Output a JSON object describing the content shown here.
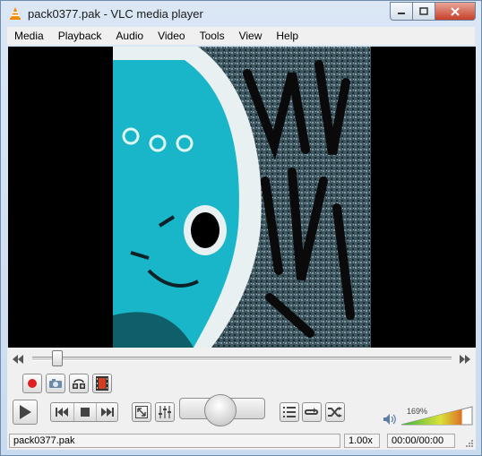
{
  "window": {
    "title": "pack0377.pak - VLC media player",
    "icon": "vlc-cone-icon"
  },
  "caption_buttons": {
    "minimize_icon": "minimize-icon",
    "maximize_icon": "maximize-icon",
    "close_icon": "close-icon"
  },
  "menubar": {
    "items": [
      {
        "label": "Media"
      },
      {
        "label": "Playback"
      },
      {
        "label": "Audio"
      },
      {
        "label": "Video"
      },
      {
        "label": "Tools"
      },
      {
        "label": "View"
      },
      {
        "label": "Help"
      }
    ]
  },
  "video": {
    "artwork": "cover-art-image"
  },
  "seek": {
    "position_fraction": 0.06
  },
  "toolbar_top": [
    {
      "name": "record-button",
      "icon": "record-icon"
    },
    {
      "name": "snapshot-button",
      "icon": "camera-icon"
    },
    {
      "name": "loop-ab-button",
      "icon": "loop-ab-icon"
    },
    {
      "name": "frame-by-frame-button",
      "icon": "film-frame-icon"
    }
  ],
  "toolbar_bottom": [
    {
      "name": "play-button",
      "icon": "play-icon"
    },
    {
      "name": "previous-button",
      "icon": "skip-back-icon"
    },
    {
      "name": "stop-button",
      "icon": "stop-icon"
    },
    {
      "name": "next-button",
      "icon": "skip-forward-icon"
    },
    {
      "name": "fullscreen-button",
      "icon": "fullscreen-icon"
    },
    {
      "name": "extended-settings-button",
      "icon": "equalizer-icon"
    },
    {
      "name": "playlist-button",
      "icon": "playlist-icon"
    },
    {
      "name": "loop-button",
      "icon": "repeat-icon"
    },
    {
      "name": "shuffle-button",
      "icon": "shuffle-icon"
    }
  ],
  "volume": {
    "percent_label": "169%",
    "level_fraction": 0.845,
    "icon": "speaker-icon"
  },
  "status": {
    "filename": "pack0377.pak",
    "speed": "1.00x",
    "time": "00:00/00:00"
  },
  "colors": {
    "accent_record": "#e02020",
    "volume_low": "#3cb043",
    "volume_high": "#e03a1a"
  }
}
